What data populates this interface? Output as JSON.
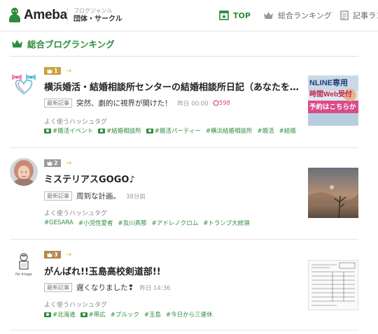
{
  "header": {
    "logo_text": "Ameba",
    "genre_label": "ブログジャンル",
    "genre_name": "団体・サークル",
    "nav": {
      "top": "TOP",
      "overall_ranking": "総合ランキング",
      "article": "記事ラン"
    }
  },
  "section": {
    "title": "総合ブログランキング"
  },
  "entries": [
    {
      "rank": "1",
      "trend": "→",
      "title": "横浜婚活・結婚相談所センターの結婚相談所日記（あなたを幸…",
      "latest_tag": "最新記事",
      "latest_text": "突然、劇的に視界が開けた！",
      "latest_time": "昨日 00:00",
      "likes": "598",
      "tags_label": "よく使うハッシュタグ",
      "tags": [
        "#婚活イベント",
        "#結婚相談所",
        "#婚活パーティー",
        "#横浜結婚相談所",
        "#婚活",
        "#結婚"
      ],
      "thumb_text1": "NLINE専用",
      "thumb_text2": "時間Web受付",
      "thumb_text3": "予約はこちらか"
    },
    {
      "rank": "2",
      "trend": "→",
      "title": "ミステリアスGOGO♪",
      "latest_tag": "最新記事",
      "latest_text": "周到な計画。",
      "latest_time": "38分前",
      "likes": "",
      "tags_label": "よく使うハッシュタグ",
      "tags": [
        "#GESARA",
        "#小児性愛者",
        "#及川真那",
        "#アドレノクロム",
        "#トランプ大統領"
      ]
    },
    {
      "rank": "3",
      "trend": "→",
      "title": "がんばれ!!玉島高校剣道部!!",
      "latest_tag": "最新記事",
      "latest_text": "遅くなりました❢",
      "latest_time": "昨日 14:36",
      "likes": "",
      "tags_label": "よく使うハッシュタグ",
      "tags": [
        "#北海道",
        "#帯広",
        "#ブルック",
        "#玉島",
        "#今日から三連休"
      ],
      "avatar_caption": "No Image"
    }
  ],
  "colors": {
    "brand_green": "#2d8c3c",
    "gold": "#c9a13b",
    "silver": "#9a9a9a",
    "bronze": "#b8864b",
    "like_pink": "#e0457b"
  }
}
